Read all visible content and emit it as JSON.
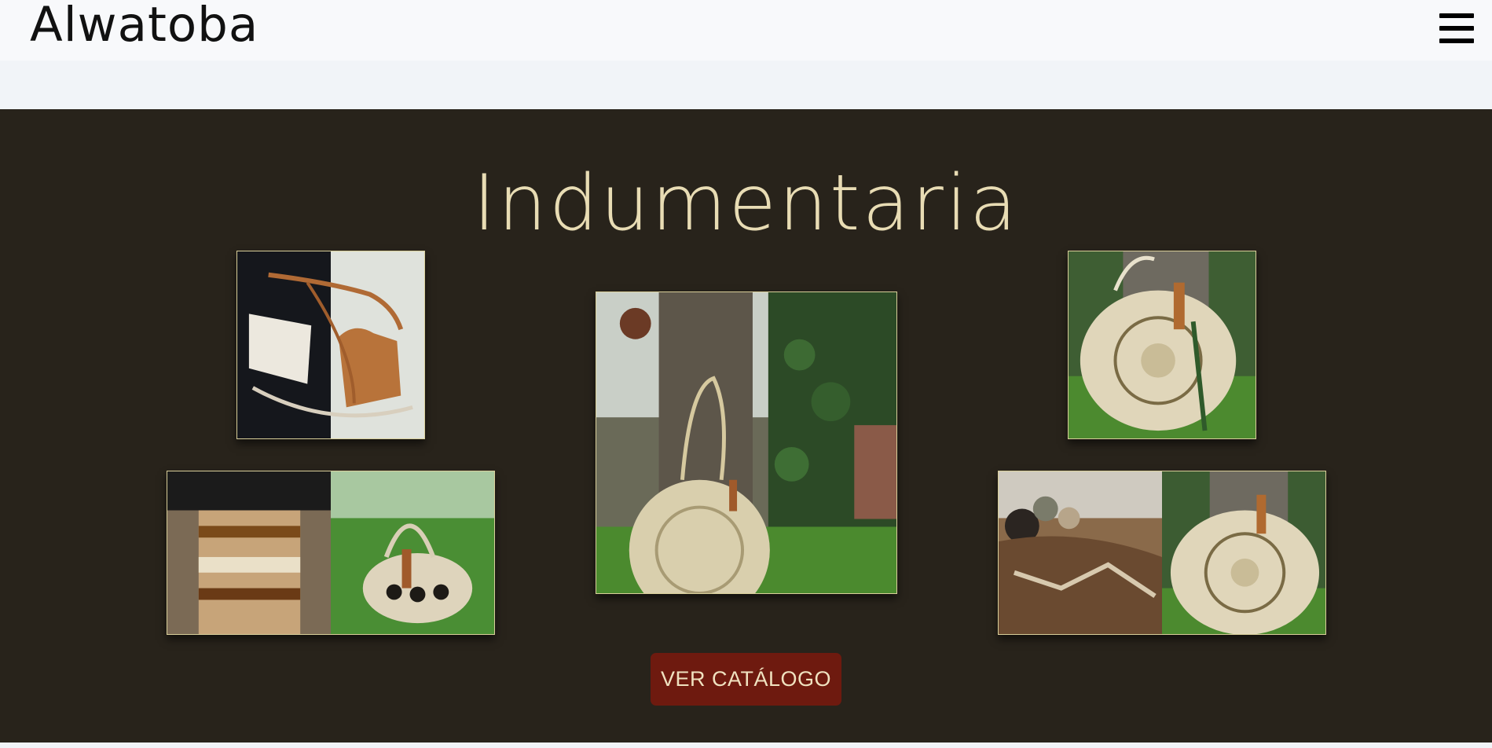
{
  "navbar": {
    "brand": "Alwatoba",
    "menu_icon": "hamburger-menu-icon"
  },
  "section": {
    "title": "Indumentaria",
    "cta_label": "VER CATÁLOGO",
    "photos": [
      {
        "name": "leather-bags-photo",
        "subject": "white and tan leather crossbody bags"
      },
      {
        "name": "palm-tree-basket-bag-photo",
        "subject": "round woven bag hanging on palm tree"
      },
      {
        "name": "round-woven-bag-photo",
        "subject": "round woven straw bag on tree"
      },
      {
        "name": "woven-skirt-and-basket-photo",
        "subject": "woven skirt and basket handbag"
      },
      {
        "name": "yarn-and-round-bag-photo",
        "subject": "yarn balls, woven fabric and round bag"
      }
    ]
  },
  "colors": {
    "section_bg": "#28231b",
    "title": "#e8dcb4",
    "cta_bg": "#6e1a0f",
    "navbar_bg": "#f8f9fb"
  }
}
